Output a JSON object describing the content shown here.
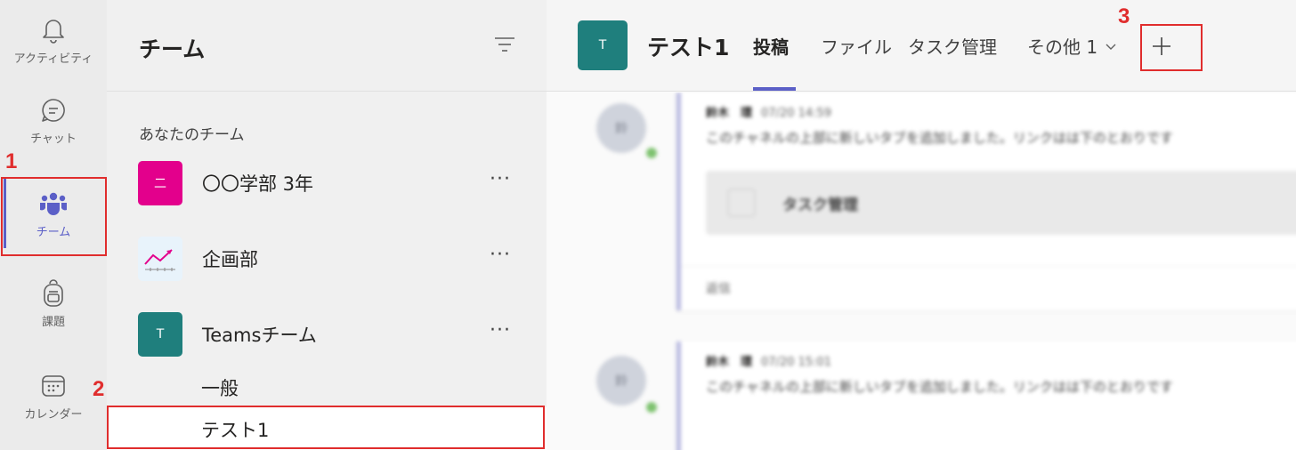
{
  "rail": {
    "items": [
      {
        "label": "アクティビティ",
        "icon": "bell-icon"
      },
      {
        "label": "チャット",
        "icon": "chat-icon"
      },
      {
        "label": "チーム",
        "icon": "teams-icon",
        "active": true
      },
      {
        "label": "課題",
        "icon": "backpack-icon"
      },
      {
        "label": "カレンダー",
        "icon": "calendar-icon"
      }
    ]
  },
  "teams_pane": {
    "title": "チーム",
    "section_label": "あなたのチーム",
    "teams": [
      {
        "name": "〇〇学部 3年",
        "avatar_text": "二",
        "avatar_color": "#e3008c"
      },
      {
        "name": "企画部",
        "avatar_text": "",
        "avatar_color": "#e8f3fb"
      },
      {
        "name": "Teamsチーム",
        "avatar_text": "T",
        "avatar_color": "#1f7f7d"
      }
    ],
    "more_label": "···",
    "channels": [
      {
        "name": "一般"
      },
      {
        "name": "テスト1",
        "selected": true
      }
    ]
  },
  "main": {
    "channel_avatar": "T",
    "channel_title": "テスト1",
    "tabs": [
      {
        "label": "投稿",
        "active": true
      },
      {
        "label": "ファイル"
      },
      {
        "label": "タスク管理"
      }
    ],
    "more_tab": "その他 1",
    "add_tab_icon": "plus-icon",
    "feed": {
      "posts": [
        {
          "avatar_text": "鈴",
          "author": "鈴木　環",
          "time": "07/20 14:59",
          "text": "このチャネルの上部に新しいタブを追加しました。リンクはは下のとおりです",
          "card_title": "タスク管理",
          "reply": "返信"
        },
        {
          "avatar_text": "鈴",
          "author": "鈴木　環",
          "time": "07/20 15:01",
          "text": "このチャネルの上部に新しいタブを追加しました。リンクはは下のとおりです"
        }
      ]
    }
  },
  "annotations": {
    "callouts": [
      "1",
      "2",
      "3"
    ],
    "color": "#e02d2d"
  },
  "colors": {
    "accent": "#5b5fc7",
    "rail_bg": "#ebebeb",
    "pane_bg": "#f0f0f0"
  }
}
